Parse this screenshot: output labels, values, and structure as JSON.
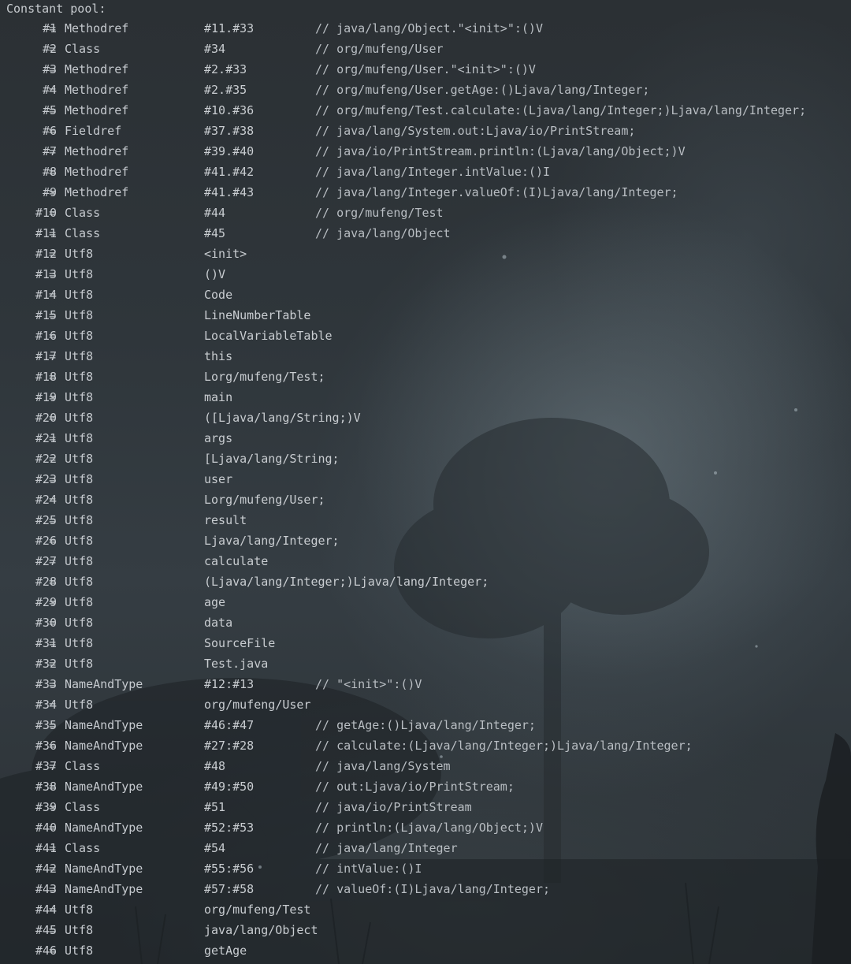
{
  "header": "Constant pool:",
  "entries": [
    {
      "idx": "#1",
      "tag": "Methodref",
      "value": "#11.#33",
      "comment": "// java/lang/Object.\"<init>\":()V"
    },
    {
      "idx": "#2",
      "tag": "Class",
      "value": "#34",
      "comment": "// org/mufeng/User"
    },
    {
      "idx": "#3",
      "tag": "Methodref",
      "value": "#2.#33",
      "comment": "// org/mufeng/User.\"<init>\":()V"
    },
    {
      "idx": "#4",
      "tag": "Methodref",
      "value": "#2.#35",
      "comment": "// org/mufeng/User.getAge:()Ljava/lang/Integer;"
    },
    {
      "idx": "#5",
      "tag": "Methodref",
      "value": "#10.#36",
      "comment": "// org/mufeng/Test.calculate:(Ljava/lang/Integer;)Ljava/lang/Integer;"
    },
    {
      "idx": "#6",
      "tag": "Fieldref",
      "value": "#37.#38",
      "comment": "// java/lang/System.out:Ljava/io/PrintStream;"
    },
    {
      "idx": "#7",
      "tag": "Methodref",
      "value": "#39.#40",
      "comment": "// java/io/PrintStream.println:(Ljava/lang/Object;)V"
    },
    {
      "idx": "#8",
      "tag": "Methodref",
      "value": "#41.#42",
      "comment": "// java/lang/Integer.intValue:()I"
    },
    {
      "idx": "#9",
      "tag": "Methodref",
      "value": "#41.#43",
      "comment": "// java/lang/Integer.valueOf:(I)Ljava/lang/Integer;"
    },
    {
      "idx": "#10",
      "tag": "Class",
      "value": "#44",
      "comment": "// org/mufeng/Test"
    },
    {
      "idx": "#11",
      "tag": "Class",
      "value": "#45",
      "comment": "// java/lang/Object"
    },
    {
      "idx": "#12",
      "tag": "Utf8",
      "value": "<init>",
      "comment": ""
    },
    {
      "idx": "#13",
      "tag": "Utf8",
      "value": "()V",
      "comment": ""
    },
    {
      "idx": "#14",
      "tag": "Utf8",
      "value": "Code",
      "comment": ""
    },
    {
      "idx": "#15",
      "tag": "Utf8",
      "value": "LineNumberTable",
      "comment": ""
    },
    {
      "idx": "#16",
      "tag": "Utf8",
      "value": "LocalVariableTable",
      "comment": ""
    },
    {
      "idx": "#17",
      "tag": "Utf8",
      "value": "this",
      "comment": ""
    },
    {
      "idx": "#18",
      "tag": "Utf8",
      "value": "Lorg/mufeng/Test;",
      "comment": ""
    },
    {
      "idx": "#19",
      "tag": "Utf8",
      "value": "main",
      "comment": ""
    },
    {
      "idx": "#20",
      "tag": "Utf8",
      "value": "([Ljava/lang/String;)V",
      "comment": ""
    },
    {
      "idx": "#21",
      "tag": "Utf8",
      "value": "args",
      "comment": ""
    },
    {
      "idx": "#22",
      "tag": "Utf8",
      "value": "[Ljava/lang/String;",
      "comment": ""
    },
    {
      "idx": "#23",
      "tag": "Utf8",
      "value": "user",
      "comment": ""
    },
    {
      "idx": "#24",
      "tag": "Utf8",
      "value": "Lorg/mufeng/User;",
      "comment": ""
    },
    {
      "idx": "#25",
      "tag": "Utf8",
      "value": "result",
      "comment": ""
    },
    {
      "idx": "#26",
      "tag": "Utf8",
      "value": "Ljava/lang/Integer;",
      "comment": ""
    },
    {
      "idx": "#27",
      "tag": "Utf8",
      "value": "calculate",
      "comment": ""
    },
    {
      "idx": "#28",
      "tag": "Utf8",
      "value": "(Ljava/lang/Integer;)Ljava/lang/Integer;",
      "comment": ""
    },
    {
      "idx": "#29",
      "tag": "Utf8",
      "value": "age",
      "comment": ""
    },
    {
      "idx": "#30",
      "tag": "Utf8",
      "value": "data",
      "comment": ""
    },
    {
      "idx": "#31",
      "tag": "Utf8",
      "value": "SourceFile",
      "comment": ""
    },
    {
      "idx": "#32",
      "tag": "Utf8",
      "value": "Test.java",
      "comment": ""
    },
    {
      "idx": "#33",
      "tag": "NameAndType",
      "value": "#12:#13",
      "comment": "// \"<init>\":()V"
    },
    {
      "idx": "#34",
      "tag": "Utf8",
      "value": "org/mufeng/User",
      "comment": ""
    },
    {
      "idx": "#35",
      "tag": "NameAndType",
      "value": "#46:#47",
      "comment": "// getAge:()Ljava/lang/Integer;"
    },
    {
      "idx": "#36",
      "tag": "NameAndType",
      "value": "#27:#28",
      "comment": "// calculate:(Ljava/lang/Integer;)Ljava/lang/Integer;"
    },
    {
      "idx": "#37",
      "tag": "Class",
      "value": "#48",
      "comment": "// java/lang/System"
    },
    {
      "idx": "#38",
      "tag": "NameAndType",
      "value": "#49:#50",
      "comment": "// out:Ljava/io/PrintStream;"
    },
    {
      "idx": "#39",
      "tag": "Class",
      "value": "#51",
      "comment": "// java/io/PrintStream"
    },
    {
      "idx": "#40",
      "tag": "NameAndType",
      "value": "#52:#53",
      "comment": "// println:(Ljava/lang/Object;)V"
    },
    {
      "idx": "#41",
      "tag": "Class",
      "value": "#54",
      "comment": "// java/lang/Integer"
    },
    {
      "idx": "#42",
      "tag": "NameAndType",
      "value": "#55:#56",
      "comment": "// intValue:()I"
    },
    {
      "idx": "#43",
      "tag": "NameAndType",
      "value": "#57:#58",
      "comment": "// valueOf:(I)Ljava/lang/Integer;"
    },
    {
      "idx": "#44",
      "tag": "Utf8",
      "value": "org/mufeng/Test",
      "comment": ""
    },
    {
      "idx": "#45",
      "tag": "Utf8",
      "value": "java/lang/Object",
      "comment": ""
    },
    {
      "idx": "#46",
      "tag": "Utf8",
      "value": "getAge",
      "comment": ""
    }
  ]
}
